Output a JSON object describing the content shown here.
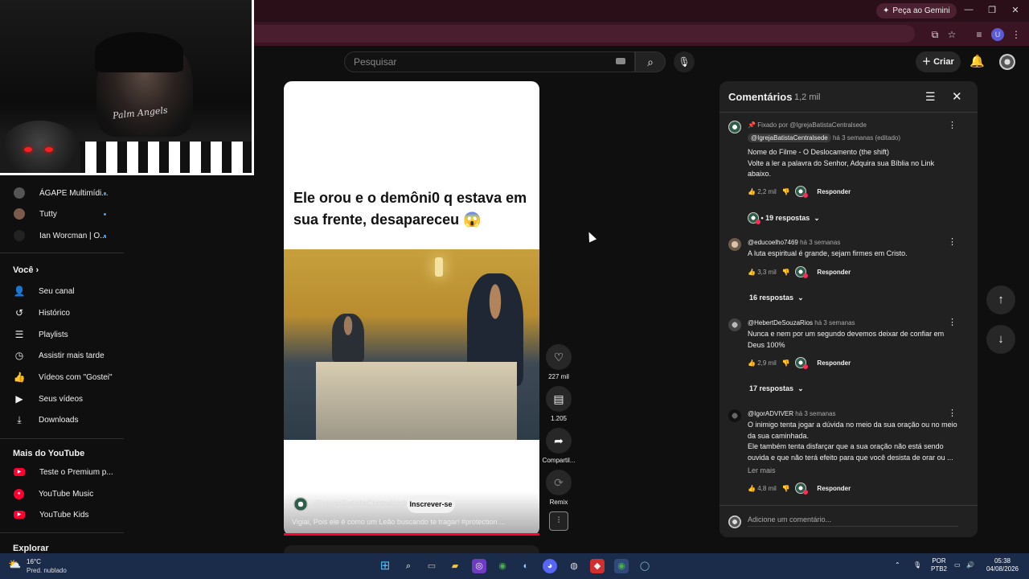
{
  "browser": {
    "gemini_label": "Peça ao Gemini",
    "profile_initial": "U"
  },
  "header": {
    "search_placeholder": "Pesquisar",
    "create_label": "Criar"
  },
  "sidebar": {
    "subscriptions": [
      {
        "label": "ÁGAPE Multimídi..."
      },
      {
        "label": "Tutty"
      },
      {
        "label": "Ian Worcman | O..."
      }
    ],
    "you_heading": "Você",
    "you_items": [
      {
        "label": "Seu canal",
        "icon": "channel-icon"
      },
      {
        "label": "Histórico",
        "icon": "history-icon"
      },
      {
        "label": "Playlists",
        "icon": "playlists-icon"
      },
      {
        "label": "Assistir mais tarde",
        "icon": "watch-later-icon"
      },
      {
        "label": "Vídeos com \"Gostei\"",
        "icon": "like-icon"
      },
      {
        "label": "Seus vídeos",
        "icon": "your-videos-icon"
      },
      {
        "label": "Downloads",
        "icon": "download-icon"
      }
    ],
    "more_heading": "Mais do YouTube",
    "more_items": [
      {
        "label": "Teste o Premium p..."
      },
      {
        "label": "YouTube Music"
      },
      {
        "label": "YouTube Kids"
      }
    ],
    "explore_heading": "Explorar"
  },
  "webcam": {
    "brand_text": "Palm Angels"
  },
  "short": {
    "title": "Ele orou e o demôni0 q estava em sua frente, desapareceu 😱",
    "channel": "@IgrejaBatistaCentralsede",
    "subscribe_label": "Inscrever-se",
    "description": "Vigiai, Pois ele é como um Leão buscando te tragar! #protection ...",
    "likes": "227 mil",
    "comments": "1.205",
    "share_label": "Compartil...",
    "remix_label": "Remix"
  },
  "comments": {
    "title": "Comentários",
    "count": "1,2 mil",
    "add_placeholder": "Adicione um comentário...",
    "items": [
      {
        "pinned": "Fixado por @IgrejaBatistaCentralsede",
        "author": "@IgrejaBatistaCentralsede",
        "time": "há 3 semanas (editado)",
        "text": [
          "Nome do Filme - O Deslocamento (the shift)",
          "Volte a ler a palavra do Senhor, Adquira sua Bíblia no Link abaixo."
        ],
        "likes": "2,2 mil",
        "reply_label": "Responder",
        "replies": "• 19 respostas"
      },
      {
        "author": "@educoelho7469",
        "time": "há 3 semanas",
        "text": [
          "A luta espiritual é grande,  sejam firmes em Cristo."
        ],
        "likes": "3,3 mil",
        "reply_label": "Responder",
        "replies": "16 respostas"
      },
      {
        "author": "@HebertDeSouzaRios",
        "time": "há 3 semanas",
        "text": [
          "Nunca e nem por um segundo devemos deixar de confiar em Deus 100%"
        ],
        "likes": "2,9 mil",
        "reply_label": "Responder",
        "replies": "17 respostas"
      },
      {
        "author": "@IgorADVIVER",
        "time": "há 3 semanas",
        "text": [
          "O inimigo tenta jogar a dúvida no meio da sua oração ou no meio da sua caminhada.",
          "Ele também tenta disfarçar que a sua oração não está sendo ouvida e que não terá efeito para que você desista de orar ou ..."
        ],
        "more_label": "Ler mais",
        "likes": "4,8 mil",
        "reply_label": "Responder"
      }
    ]
  },
  "taskbar": {
    "temp": "16°C",
    "weather": "Pred. nublado",
    "lang": "POR",
    "layout": "PTB2",
    "time": "05:38",
    "date": "04/08/2026"
  },
  "colors": {
    "accent_red": "#ff0033",
    "link_blue": "#3ea6ff",
    "panel_bg": "#212121"
  }
}
